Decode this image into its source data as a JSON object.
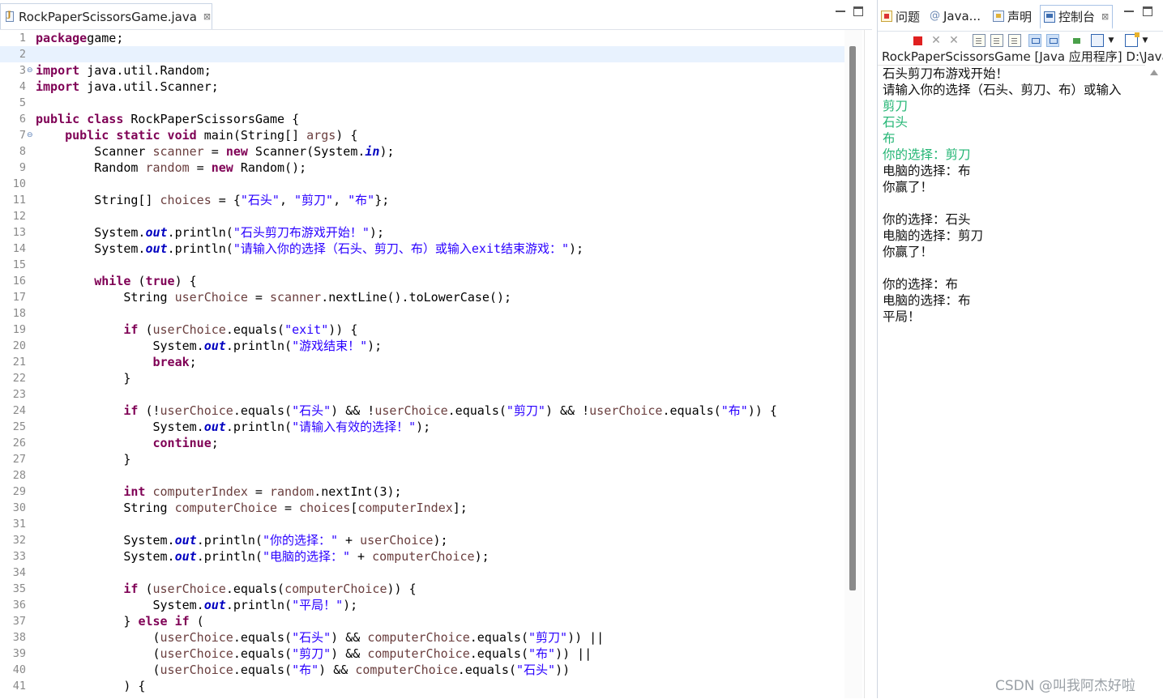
{
  "editor": {
    "tab_label": "RockPaperScissorsGame.java",
    "tab_close": "⊠",
    "lines": [
      {
        "n": "1",
        "fold": "",
        "segs": [
          [
            "kw",
            "package"
          ],
          [
            "",
            "game;"
          ]
        ]
      },
      {
        "n": "2",
        "fold": "",
        "current": true,
        "segs": []
      },
      {
        "n": "3",
        "fold": "⊖",
        "segs": [
          [
            "kw",
            "import"
          ],
          [
            "",
            " java.util.Random;"
          ]
        ]
      },
      {
        "n": "4",
        "fold": "",
        "segs": [
          [
            "kw",
            "import"
          ],
          [
            "",
            " java.util.Scanner;"
          ]
        ]
      },
      {
        "n": "5",
        "fold": "",
        "segs": []
      },
      {
        "n": "6",
        "fold": "",
        "segs": [
          [
            "kw",
            "public class"
          ],
          [
            "",
            " RockPaperScissorsGame {"
          ]
        ]
      },
      {
        "n": "7",
        "fold": "⊖",
        "segs": [
          [
            "",
            "    "
          ],
          [
            "kw",
            "public static void"
          ],
          [
            "",
            " main(String[] "
          ],
          [
            "lv",
            "args"
          ],
          [
            "",
            ") {"
          ]
        ]
      },
      {
        "n": "8",
        "fold": "",
        "segs": [
          [
            "",
            "        Scanner "
          ],
          [
            "lv",
            "scanner"
          ],
          [
            "",
            " = "
          ],
          [
            "kw",
            "new"
          ],
          [
            "",
            " Scanner(System."
          ],
          [
            "sf",
            "in"
          ],
          [
            "",
            ");"
          ]
        ]
      },
      {
        "n": "9",
        "fold": "",
        "segs": [
          [
            "",
            "        Random "
          ],
          [
            "lv",
            "random"
          ],
          [
            "",
            " = "
          ],
          [
            "kw",
            "new"
          ],
          [
            "",
            " Random();"
          ]
        ]
      },
      {
        "n": "10",
        "fold": "",
        "segs": []
      },
      {
        "n": "11",
        "fold": "",
        "segs": [
          [
            "",
            "        String[] "
          ],
          [
            "lv",
            "choices"
          ],
          [
            "",
            " = {"
          ],
          [
            "st",
            "\"石头\""
          ],
          [
            "",
            ", "
          ],
          [
            "st",
            "\"剪刀\""
          ],
          [
            "",
            ", "
          ],
          [
            "st",
            "\"布\""
          ],
          [
            "",
            "};"
          ]
        ]
      },
      {
        "n": "12",
        "fold": "",
        "segs": []
      },
      {
        "n": "13",
        "fold": "",
        "segs": [
          [
            "",
            "        System."
          ],
          [
            "sf",
            "out"
          ],
          [
            "",
            ".println("
          ],
          [
            "st",
            "\"石头剪刀布游戏开始！\""
          ],
          [
            "",
            ");"
          ]
        ]
      },
      {
        "n": "14",
        "fold": "",
        "segs": [
          [
            "",
            "        System."
          ],
          [
            "sf",
            "out"
          ],
          [
            "",
            ".println("
          ],
          [
            "st",
            "\"请输入你的选择（石头、剪刀、布）或输入exit结束游戏：\""
          ],
          [
            "",
            ");"
          ]
        ]
      },
      {
        "n": "15",
        "fold": "",
        "segs": []
      },
      {
        "n": "16",
        "fold": "",
        "segs": [
          [
            "",
            "        "
          ],
          [
            "kw",
            "while"
          ],
          [
            "",
            " ("
          ],
          [
            "kw",
            "true"
          ],
          [
            "",
            ") {"
          ]
        ]
      },
      {
        "n": "17",
        "fold": "",
        "segs": [
          [
            "",
            "            String "
          ],
          [
            "lv",
            "userChoice"
          ],
          [
            "",
            " = "
          ],
          [
            "lv",
            "scanner"
          ],
          [
            "",
            ".nextLine().toLowerCase();"
          ]
        ]
      },
      {
        "n": "18",
        "fold": "",
        "segs": []
      },
      {
        "n": "19",
        "fold": "",
        "segs": [
          [
            "",
            "            "
          ],
          [
            "kw",
            "if"
          ],
          [
            "",
            " ("
          ],
          [
            "lv",
            "userChoice"
          ],
          [
            "",
            ".equals("
          ],
          [
            "st",
            "\"exit\""
          ],
          [
            "",
            ")) {"
          ]
        ]
      },
      {
        "n": "20",
        "fold": "",
        "segs": [
          [
            "",
            "                System."
          ],
          [
            "sf",
            "out"
          ],
          [
            "",
            ".println("
          ],
          [
            "st",
            "\"游戏结束！\""
          ],
          [
            "",
            ");"
          ]
        ]
      },
      {
        "n": "21",
        "fold": "",
        "segs": [
          [
            "",
            "                "
          ],
          [
            "kw",
            "break"
          ],
          [
            "",
            ";"
          ]
        ]
      },
      {
        "n": "22",
        "fold": "",
        "segs": [
          [
            "",
            "            }"
          ]
        ]
      },
      {
        "n": "23",
        "fold": "",
        "segs": []
      },
      {
        "n": "24",
        "fold": "",
        "segs": [
          [
            "",
            "            "
          ],
          [
            "kw",
            "if"
          ],
          [
            "",
            " (!"
          ],
          [
            "lv",
            "userChoice"
          ],
          [
            "",
            ".equals("
          ],
          [
            "st",
            "\"石头\""
          ],
          [
            "",
            ") && !"
          ],
          [
            "lv",
            "userChoice"
          ],
          [
            "",
            ".equals("
          ],
          [
            "st",
            "\"剪刀\""
          ],
          [
            "",
            ") && !"
          ],
          [
            "lv",
            "userChoice"
          ],
          [
            "",
            ".equals("
          ],
          [
            "st",
            "\"布\""
          ],
          [
            "",
            ")) {"
          ]
        ]
      },
      {
        "n": "25",
        "fold": "",
        "segs": [
          [
            "",
            "                System."
          ],
          [
            "sf",
            "out"
          ],
          [
            "",
            ".println("
          ],
          [
            "st",
            "\"请输入有效的选择！\""
          ],
          [
            "",
            ");"
          ]
        ]
      },
      {
        "n": "26",
        "fold": "",
        "segs": [
          [
            "",
            "                "
          ],
          [
            "kw",
            "continue"
          ],
          [
            "",
            ";"
          ]
        ]
      },
      {
        "n": "27",
        "fold": "",
        "segs": [
          [
            "",
            "            }"
          ]
        ]
      },
      {
        "n": "28",
        "fold": "",
        "segs": []
      },
      {
        "n": "29",
        "fold": "",
        "segs": [
          [
            "",
            "            "
          ],
          [
            "kw",
            "int"
          ],
          [
            " lv",
            " computerIndex"
          ],
          [
            "",
            " = "
          ],
          [
            "lv",
            "random"
          ],
          [
            "",
            ".nextInt(3);"
          ]
        ]
      },
      {
        "n": "30",
        "fold": "",
        "segs": [
          [
            "",
            "            String "
          ],
          [
            "lv",
            "computerChoice"
          ],
          [
            "",
            " = "
          ],
          [
            "lv",
            "choices"
          ],
          [
            "",
            "["
          ],
          [
            "lv",
            "computerIndex"
          ],
          [
            "",
            "];"
          ]
        ]
      },
      {
        "n": "31",
        "fold": "",
        "segs": []
      },
      {
        "n": "32",
        "fold": "",
        "segs": [
          [
            "",
            "            System."
          ],
          [
            "sf",
            "out"
          ],
          [
            "",
            ".println("
          ],
          [
            "st",
            "\"你的选择：\""
          ],
          [
            "",
            " + "
          ],
          [
            "lv",
            "userChoice"
          ],
          [
            "",
            ");"
          ]
        ]
      },
      {
        "n": "33",
        "fold": "",
        "segs": [
          [
            "",
            "            System."
          ],
          [
            "sf",
            "out"
          ],
          [
            "",
            ".println("
          ],
          [
            "st",
            "\"电脑的选择：\""
          ],
          [
            "",
            " + "
          ],
          [
            "lv",
            "computerChoice"
          ],
          [
            "",
            ");"
          ]
        ]
      },
      {
        "n": "34",
        "fold": "",
        "segs": []
      },
      {
        "n": "35",
        "fold": "",
        "segs": [
          [
            "",
            "            "
          ],
          [
            "kw",
            "if"
          ],
          [
            "",
            " ("
          ],
          [
            "lv",
            "userChoice"
          ],
          [
            "",
            ".equals("
          ],
          [
            "lv",
            "computerChoice"
          ],
          [
            "",
            ")) {"
          ]
        ]
      },
      {
        "n": "36",
        "fold": "",
        "segs": [
          [
            "",
            "                System."
          ],
          [
            "sf",
            "out"
          ],
          [
            "",
            ".println("
          ],
          [
            "st",
            "\"平局！\""
          ],
          [
            "",
            ");"
          ]
        ]
      },
      {
        "n": "37",
        "fold": "",
        "segs": [
          [
            "",
            "            } "
          ],
          [
            "kw",
            "else if"
          ],
          [
            "",
            " ("
          ]
        ]
      },
      {
        "n": "38",
        "fold": "",
        "segs": [
          [
            "",
            "                ("
          ],
          [
            "lv",
            "userChoice"
          ],
          [
            "",
            ".equals("
          ],
          [
            "st",
            "\"石头\""
          ],
          [
            "",
            ") && "
          ],
          [
            "lv",
            "computerChoice"
          ],
          [
            "",
            ".equals("
          ],
          [
            "st",
            "\"剪刀\""
          ],
          [
            "",
            ")) ||"
          ]
        ]
      },
      {
        "n": "39",
        "fold": "",
        "segs": [
          [
            "",
            "                ("
          ],
          [
            "lv",
            "userChoice"
          ],
          [
            "",
            ".equals("
          ],
          [
            "st",
            "\"剪刀\""
          ],
          [
            "",
            ") && "
          ],
          [
            "lv",
            "computerChoice"
          ],
          [
            "",
            ".equals("
          ],
          [
            "st",
            "\"布\""
          ],
          [
            "",
            ")) ||"
          ]
        ]
      },
      {
        "n": "40",
        "fold": "",
        "segs": [
          [
            "",
            "                ("
          ],
          [
            "lv",
            "userChoice"
          ],
          [
            "",
            ".equals("
          ],
          [
            "st",
            "\"布\""
          ],
          [
            "",
            ") && "
          ],
          [
            "lv",
            "computerChoice"
          ],
          [
            "",
            ".equals("
          ],
          [
            "st",
            "\"石头\""
          ],
          [
            "",
            "))"
          ]
        ]
      },
      {
        "n": "41",
        "fold": "",
        "segs": [
          [
            "",
            "            ) {"
          ]
        ]
      }
    ]
  },
  "side_tabs": [
    {
      "label": "问题",
      "icon": "problems-icon"
    },
    {
      "label": "Java...",
      "icon": "javadoc-icon"
    },
    {
      "label": "声明",
      "icon": "declaration-icon"
    },
    {
      "label": "控制台",
      "icon": "console-icon",
      "active": true,
      "close": "⊠"
    }
  ],
  "console": {
    "title": "RockPaperScissorsGame [Java 应用程序] D:\\Java\\",
    "output": [
      {
        "text": "石头剪刀布游戏开始！",
        "kind": "out"
      },
      {
        "text": "请输入你的选择（石头、剪刀、布）或输入",
        "kind": "out"
      },
      {
        "text": "剪刀",
        "kind": "input"
      },
      {
        "text": "石头",
        "kind": "input"
      },
      {
        "text": "布",
        "kind": "input"
      },
      {
        "text": "你的选择：剪刀",
        "kind": "input"
      },
      {
        "text": "电脑的选择：布",
        "kind": "out"
      },
      {
        "text": "你赢了！",
        "kind": "out"
      },
      {
        "text": "",
        "kind": "out"
      },
      {
        "text": "你的选择：石头",
        "kind": "out"
      },
      {
        "text": "电脑的选择：剪刀",
        "kind": "out"
      },
      {
        "text": "你赢了！",
        "kind": "out"
      },
      {
        "text": "",
        "kind": "out"
      },
      {
        "text": "你的选择：布",
        "kind": "out"
      },
      {
        "text": "电脑的选择：布",
        "kind": "out"
      },
      {
        "text": "平局！",
        "kind": "out"
      }
    ]
  },
  "watermark": "CSDN @叫我阿杰好啦",
  "colors": {
    "keyword": "#7f0055",
    "string": "#2a00ff",
    "local_var": "#6a3e3e",
    "static_field": "#0000c0",
    "console_input": "#22b573",
    "terminate": "#e02020"
  }
}
